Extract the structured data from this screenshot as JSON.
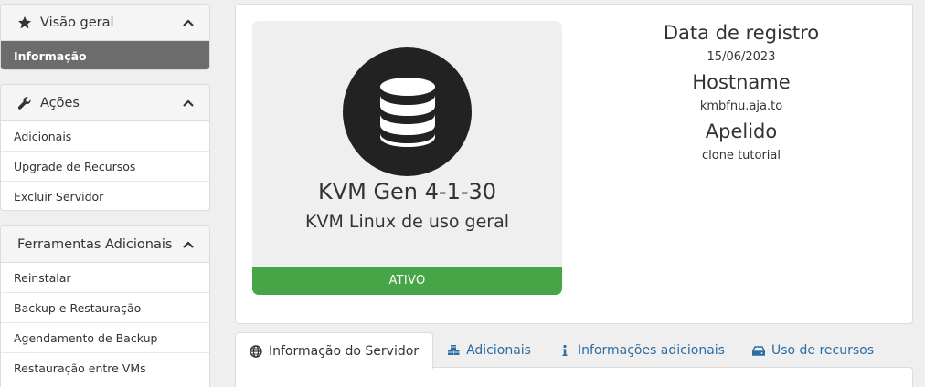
{
  "sidebar": {
    "overview": {
      "title": "Visão geral",
      "items": [
        {
          "label": "Informação"
        }
      ]
    },
    "actions": {
      "title": "Ações",
      "items": [
        {
          "label": "Adicionais"
        },
        {
          "label": "Upgrade de Recursos"
        },
        {
          "label": "Excluir Servidor"
        }
      ]
    },
    "tools": {
      "title": "Ferramentas Adicionais",
      "items": [
        {
          "label": "Reinstalar"
        },
        {
          "label": "Backup e Restauração"
        },
        {
          "label": "Agendamento de Backup"
        },
        {
          "label": "Restauração entre VMs"
        }
      ]
    }
  },
  "product": {
    "name": "KVM Gen 4-1-30",
    "group": "KVM Linux de uso geral",
    "status": "ATIVO",
    "status_color": "#46a546",
    "icon": "database-icon"
  },
  "details": {
    "registration_label": "Data de registro",
    "registration_value": "15/06/2023",
    "hostname_label": "Hostname",
    "hostname_value": "kmbfnu.aja.to",
    "nickname_label": "Apelido",
    "nickname_value": "clone tutorial"
  },
  "tabs": [
    {
      "label": "Informação do Servidor",
      "icon": "globe-icon",
      "active": true
    },
    {
      "label": "Adicionais",
      "icon": "cubes-icon",
      "active": false
    },
    {
      "label": "Informações adicionais",
      "icon": "info-icon",
      "active": false
    },
    {
      "label": "Uso de recursos",
      "icon": "hdd-icon",
      "active": false
    }
  ],
  "colors": {
    "link": "#2b6ca3",
    "active_item_bg": "#6c6c6c"
  }
}
